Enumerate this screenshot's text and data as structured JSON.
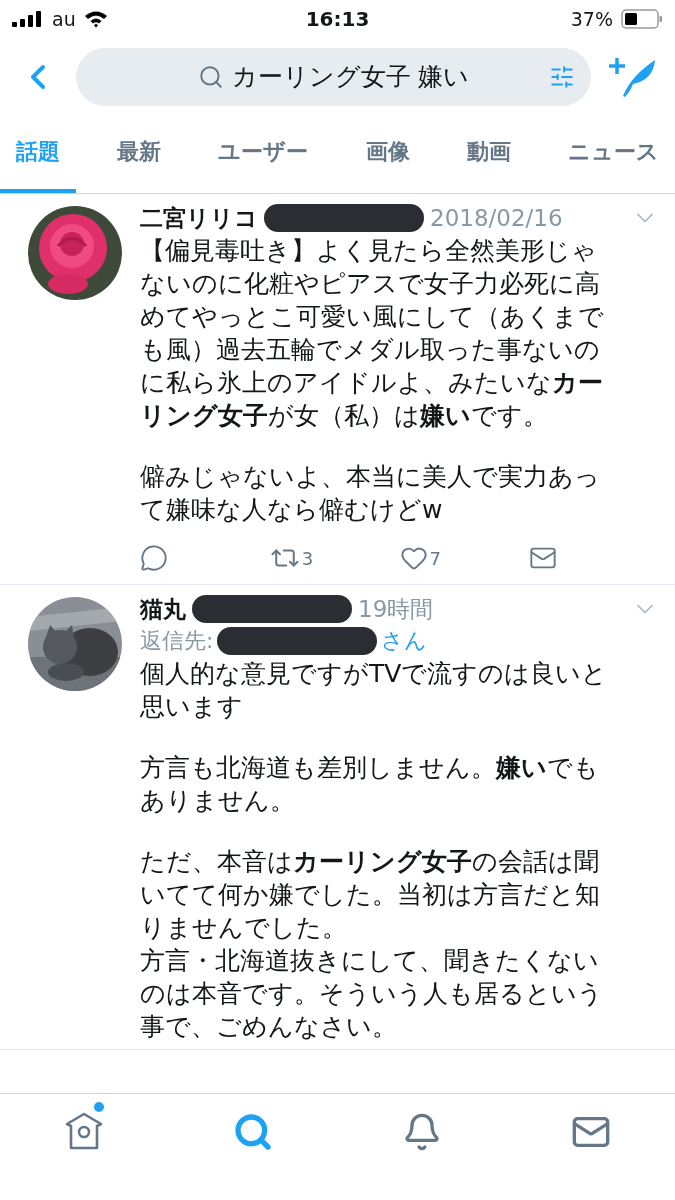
{
  "status_bar": {
    "carrier": "au",
    "time": "16:13",
    "battery": "37%"
  },
  "search": {
    "query": "カーリング女子 嫌い"
  },
  "tabs": [
    {
      "label": "話題",
      "selected": true
    },
    {
      "label": "最新",
      "selected": false
    },
    {
      "label": "ユーザー",
      "selected": false
    },
    {
      "label": "画像",
      "selected": false
    },
    {
      "label": "動画",
      "selected": false
    },
    {
      "label": "ニュース",
      "selected": false
    }
  ],
  "tweets": [
    {
      "name": "二宮リリコ",
      "time": "2018/02/16",
      "body": [
        [
          "【偏見毒吐き】よく見たら全然美形じゃないのに化粧やピアスで女子力必死に高めてやっとこ可愛い風にして（あくまでも風）過去五輪でメダル取った事ないのに私ら氷上のアイドルよ、みたいな**カーリング女子**が女（私）は**嫌い**です。"
        ],
        [
          "僻みじゃないよ、本当に美人で実力あって嫌味な人なら僻むけどw"
        ]
      ],
      "actions": [
        {
          "kind": "reply"
        },
        {
          "kind": "retweet",
          "count": "3"
        },
        {
          "kind": "like",
          "count": "7"
        },
        {
          "kind": "message"
        }
      ]
    },
    {
      "name": "猫丸",
      "time": "19時間",
      "reply_label": "返信先:",
      "reply_suffix": "さん",
      "body": [
        [
          "個人的な意見ですがTVで流すのは良いと思います"
        ],
        [
          "方言も北海道も差別しません。**嫌い**でもありません。"
        ],
        [
          "ただ、本音は**カーリング女子**の会話は聞いてて何か嫌でした。当初は方言だと知りませんでした。",
          "方言・北海道抜きにして、聞きたくないのは本音です。そういう人も居るという事で、ごめんなさい。"
        ]
      ]
    }
  ],
  "bottom_nav": [
    {
      "kind": "home",
      "selected": false,
      "badge": true
    },
    {
      "kind": "search",
      "selected": true,
      "badge": false
    },
    {
      "kind": "notifications",
      "selected": false,
      "badge": false
    },
    {
      "kind": "messages",
      "selected": false,
      "badge": false
    }
  ]
}
